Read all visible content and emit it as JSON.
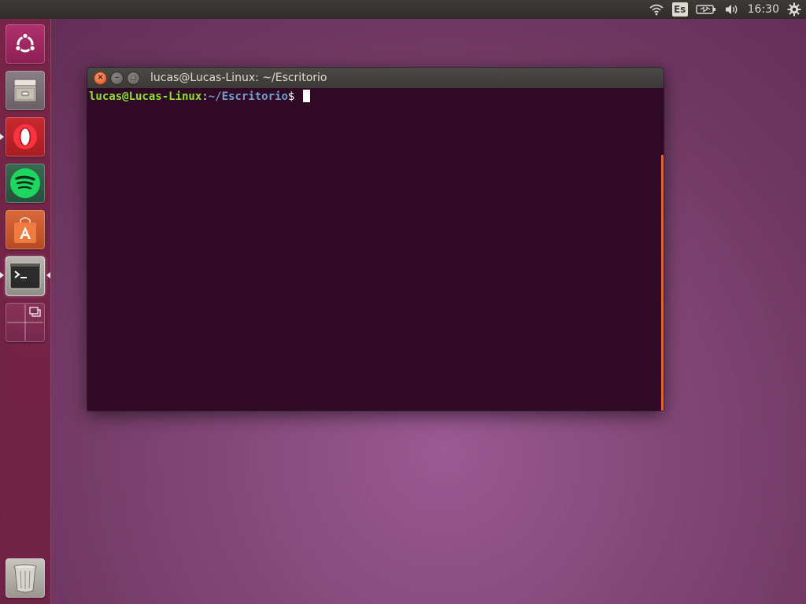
{
  "top_panel": {
    "keyboard_layout": "Es",
    "clock": "16:30",
    "icons": [
      "wifi-icon",
      "battery-icon",
      "volume-icon",
      "settings-gear-icon"
    ]
  },
  "launcher": {
    "items": [
      {
        "name": "dash-home",
        "icon": "ubuntu-logo-icon"
      },
      {
        "name": "files",
        "icon": "file-cabinet-icon"
      },
      {
        "name": "opera",
        "icon": "opera-logo-icon"
      },
      {
        "name": "spotify",
        "icon": "spotify-logo-icon"
      },
      {
        "name": "ubuntu-software",
        "icon": "shopping-bag-icon"
      },
      {
        "name": "terminal",
        "icon": "terminal-icon",
        "active": true
      },
      {
        "name": "workspace-switcher",
        "icon": "workspaces-icon"
      },
      {
        "name": "trash",
        "icon": "trash-icon"
      }
    ]
  },
  "terminal": {
    "title": "lucas@Lucas-Linux: ~/Escritorio",
    "prompt_user_host": "lucas@Lucas-Linux",
    "prompt_colon": ":",
    "prompt_path": "~/Escritorio",
    "prompt_symbol": "$ "
  },
  "colors": {
    "terminal_bg": "#300a24",
    "prompt_user": "#8ae234",
    "prompt_path": "#729fcf",
    "accent": "#e0643a"
  }
}
